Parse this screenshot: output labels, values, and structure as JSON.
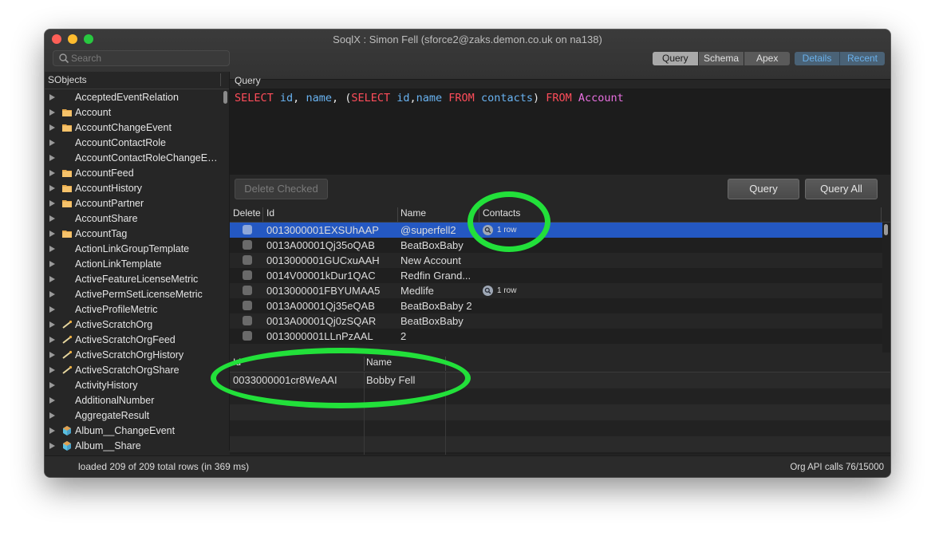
{
  "window": {
    "title": "SoqlX : Simon Fell (sforce2@zaks.demon.co.uk on na138)"
  },
  "toolbar": {
    "search_placeholder": "Search",
    "view_tabs": [
      {
        "label": "Query",
        "active": true
      },
      {
        "label": "Schema",
        "active": false
      },
      {
        "label": "Apex",
        "active": false
      }
    ],
    "panel_tabs": [
      {
        "label": "Details"
      },
      {
        "label": "Recent"
      }
    ]
  },
  "sidebar": {
    "header": "SObjects",
    "items": [
      {
        "label": "AcceptedEventRelation",
        "icon": "none"
      },
      {
        "label": "Account",
        "icon": "folder"
      },
      {
        "label": "AccountChangeEvent",
        "icon": "folder"
      },
      {
        "label": "AccountContactRole",
        "icon": "none"
      },
      {
        "label": "AccountContactRoleChangeEv...",
        "icon": "none"
      },
      {
        "label": "AccountFeed",
        "icon": "folder"
      },
      {
        "label": "AccountHistory",
        "icon": "folder"
      },
      {
        "label": "AccountPartner",
        "icon": "folder"
      },
      {
        "label": "AccountShare",
        "icon": "none"
      },
      {
        "label": "AccountTag",
        "icon": "folder"
      },
      {
        "label": "ActionLinkGroupTemplate",
        "icon": "none"
      },
      {
        "label": "ActionLinkTemplate",
        "icon": "none"
      },
      {
        "label": "ActiveFeatureLicenseMetric",
        "icon": "none"
      },
      {
        "label": "ActivePermSetLicenseMetric",
        "icon": "none"
      },
      {
        "label": "ActiveProfileMetric",
        "icon": "none"
      },
      {
        "label": "ActiveScratchOrg",
        "icon": "wand"
      },
      {
        "label": "ActiveScratchOrgFeed",
        "icon": "wand"
      },
      {
        "label": "ActiveScratchOrgHistory",
        "icon": "wand"
      },
      {
        "label": "ActiveScratchOrgShare",
        "icon": "wand"
      },
      {
        "label": "ActivityHistory",
        "icon": "none"
      },
      {
        "label": "AdditionalNumber",
        "icon": "none"
      },
      {
        "label": "AggregateResult",
        "icon": "none"
      },
      {
        "label": "Album__ChangeEvent",
        "icon": "cube"
      },
      {
        "label": "Album__Share",
        "icon": "cube"
      }
    ]
  },
  "query": {
    "label": "Query",
    "tokens": [
      {
        "t": "SELECT ",
        "c": "kw"
      },
      {
        "t": "id",
        "c": "fld"
      },
      {
        "t": ", ",
        "c": "pl"
      },
      {
        "t": "name",
        "c": "fld"
      },
      {
        "t": ", (",
        "c": "pl"
      },
      {
        "t": "SELECT ",
        "c": "kw"
      },
      {
        "t": "id",
        "c": "fld"
      },
      {
        "t": ",",
        "c": "pl"
      },
      {
        "t": "name ",
        "c": "fld"
      },
      {
        "t": "FROM ",
        "c": "kw"
      },
      {
        "t": "contacts",
        "c": "fld"
      },
      {
        "t": ") ",
        "c": "pl"
      },
      {
        "t": "FROM ",
        "c": "kw"
      },
      {
        "t": "Account",
        "c": "obj"
      }
    ]
  },
  "buttons": {
    "delete_checked": "Delete Checked",
    "query": "Query",
    "query_all": "Query All"
  },
  "results": {
    "columns": [
      "Delete",
      "Id",
      "Name",
      "Contacts"
    ],
    "rows": [
      {
        "id": "0013000001EXSUhAAP",
        "name": "@superfell2",
        "contacts": "1 row",
        "selected": true
      },
      {
        "id": "0013A00001Qj35oQAB",
        "name": "BeatBoxBaby",
        "contacts": ""
      },
      {
        "id": "0013000001GUCxuAAH",
        "name": "New Account",
        "contacts": ""
      },
      {
        "id": "0014V00001kDur1QAC",
        "name": "Redfin Grand...",
        "contacts": ""
      },
      {
        "id": "0013000001FBYUMAA5",
        "name": "Medlife",
        "contacts": "1 row"
      },
      {
        "id": "0013A00001Qj35eQAB",
        "name": "BeatBoxBaby 2",
        "contacts": ""
      },
      {
        "id": "0013A00001Qj0zSQAR",
        "name": "BeatBoxBaby",
        "contacts": ""
      },
      {
        "id": "0013000001LLnPzAAL",
        "name": "2",
        "contacts": ""
      }
    ]
  },
  "subresults": {
    "columns": [
      "Id",
      "Name"
    ],
    "rows": [
      {
        "id": "0033000001cr8WeAAI",
        "name": "Bobby Fell"
      }
    ]
  },
  "status": {
    "left": "loaded 209 of 209 total rows (in 369 ms)",
    "right": "Org API calls 76/15000"
  },
  "colors": {
    "highlight": "#22e03a",
    "selection": "#2458c2",
    "keyword": "#ff4d5a",
    "field": "#69b3f2",
    "object": "#e870e0"
  }
}
